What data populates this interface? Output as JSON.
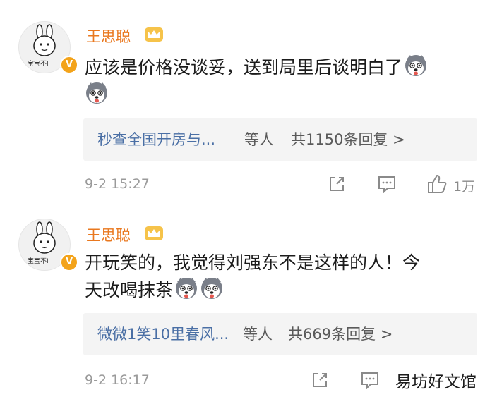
{
  "comments": [
    {
      "username": "王思聪",
      "avatar_caption": "宝宝不I",
      "content_line1": "应该是价格没谈妥，送到局里后谈明白了",
      "content_line2": "",
      "emojis": [
        "husky-emoji",
        "husky-emoji"
      ],
      "reply_names": "秒查全国开房与...",
      "reply_suffix": "等人",
      "reply_count": "共1150条回复 >",
      "time": "9-2 15:27",
      "likes": "1万"
    },
    {
      "username": "王思聪",
      "avatar_caption": "宝宝不I",
      "content_line1": "开玩笑的，我觉得刘强东不是这样的人！今",
      "content_line2": "天改喝抹茶",
      "emojis": [
        "husky-emoji",
        "husky-emoji"
      ],
      "reply_names": "微微1笑10里春风...",
      "reply_suffix": "等人",
      "reply_count": "共669条回复 >",
      "time": "9-2 16:17",
      "likes": ""
    }
  ],
  "watermark": "易坊好文馆",
  "colors": {
    "username": "#e9781f",
    "reply_link": "#4a6fa5",
    "badge": "#f3a31a"
  }
}
